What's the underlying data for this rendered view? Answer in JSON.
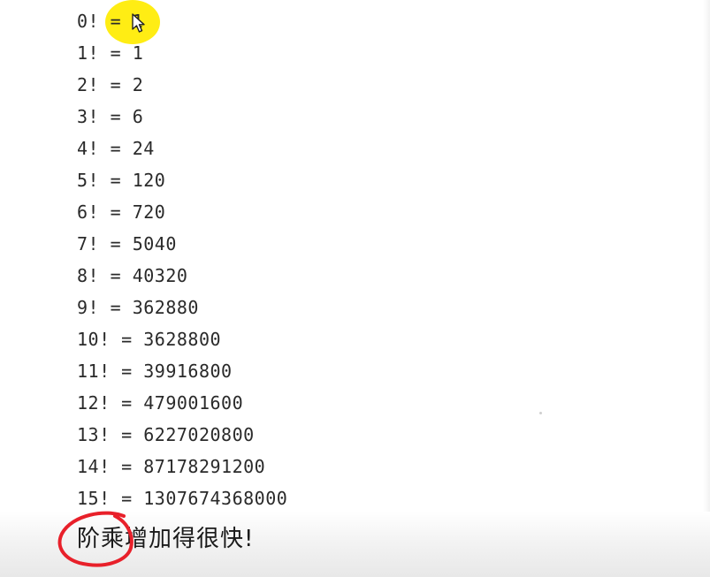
{
  "output_lines": [
    "0! = 1",
    "1! = 1",
    "2! = 2",
    "3! = 6",
    "4! = 24",
    "5! = 120",
    "6! = 720",
    "7! = 5040",
    "8! = 40320",
    "9! = 362880",
    "10! = 3628800",
    "11! = 39916800",
    "12! = 479001600",
    "13! = 6227020800",
    "14! = 87178291200",
    "15! = 1307674368000"
  ],
  "caption": "阶乘增加得很快!",
  "colors": {
    "highlight": "#ffeb00",
    "annotation": "#e8202a",
    "text": "#2a2a2a"
  },
  "icons": {
    "cursor": "mouse-pointer-icon",
    "highlight": "cursor-highlight",
    "annotation": "red-hand-drawn-circle"
  }
}
